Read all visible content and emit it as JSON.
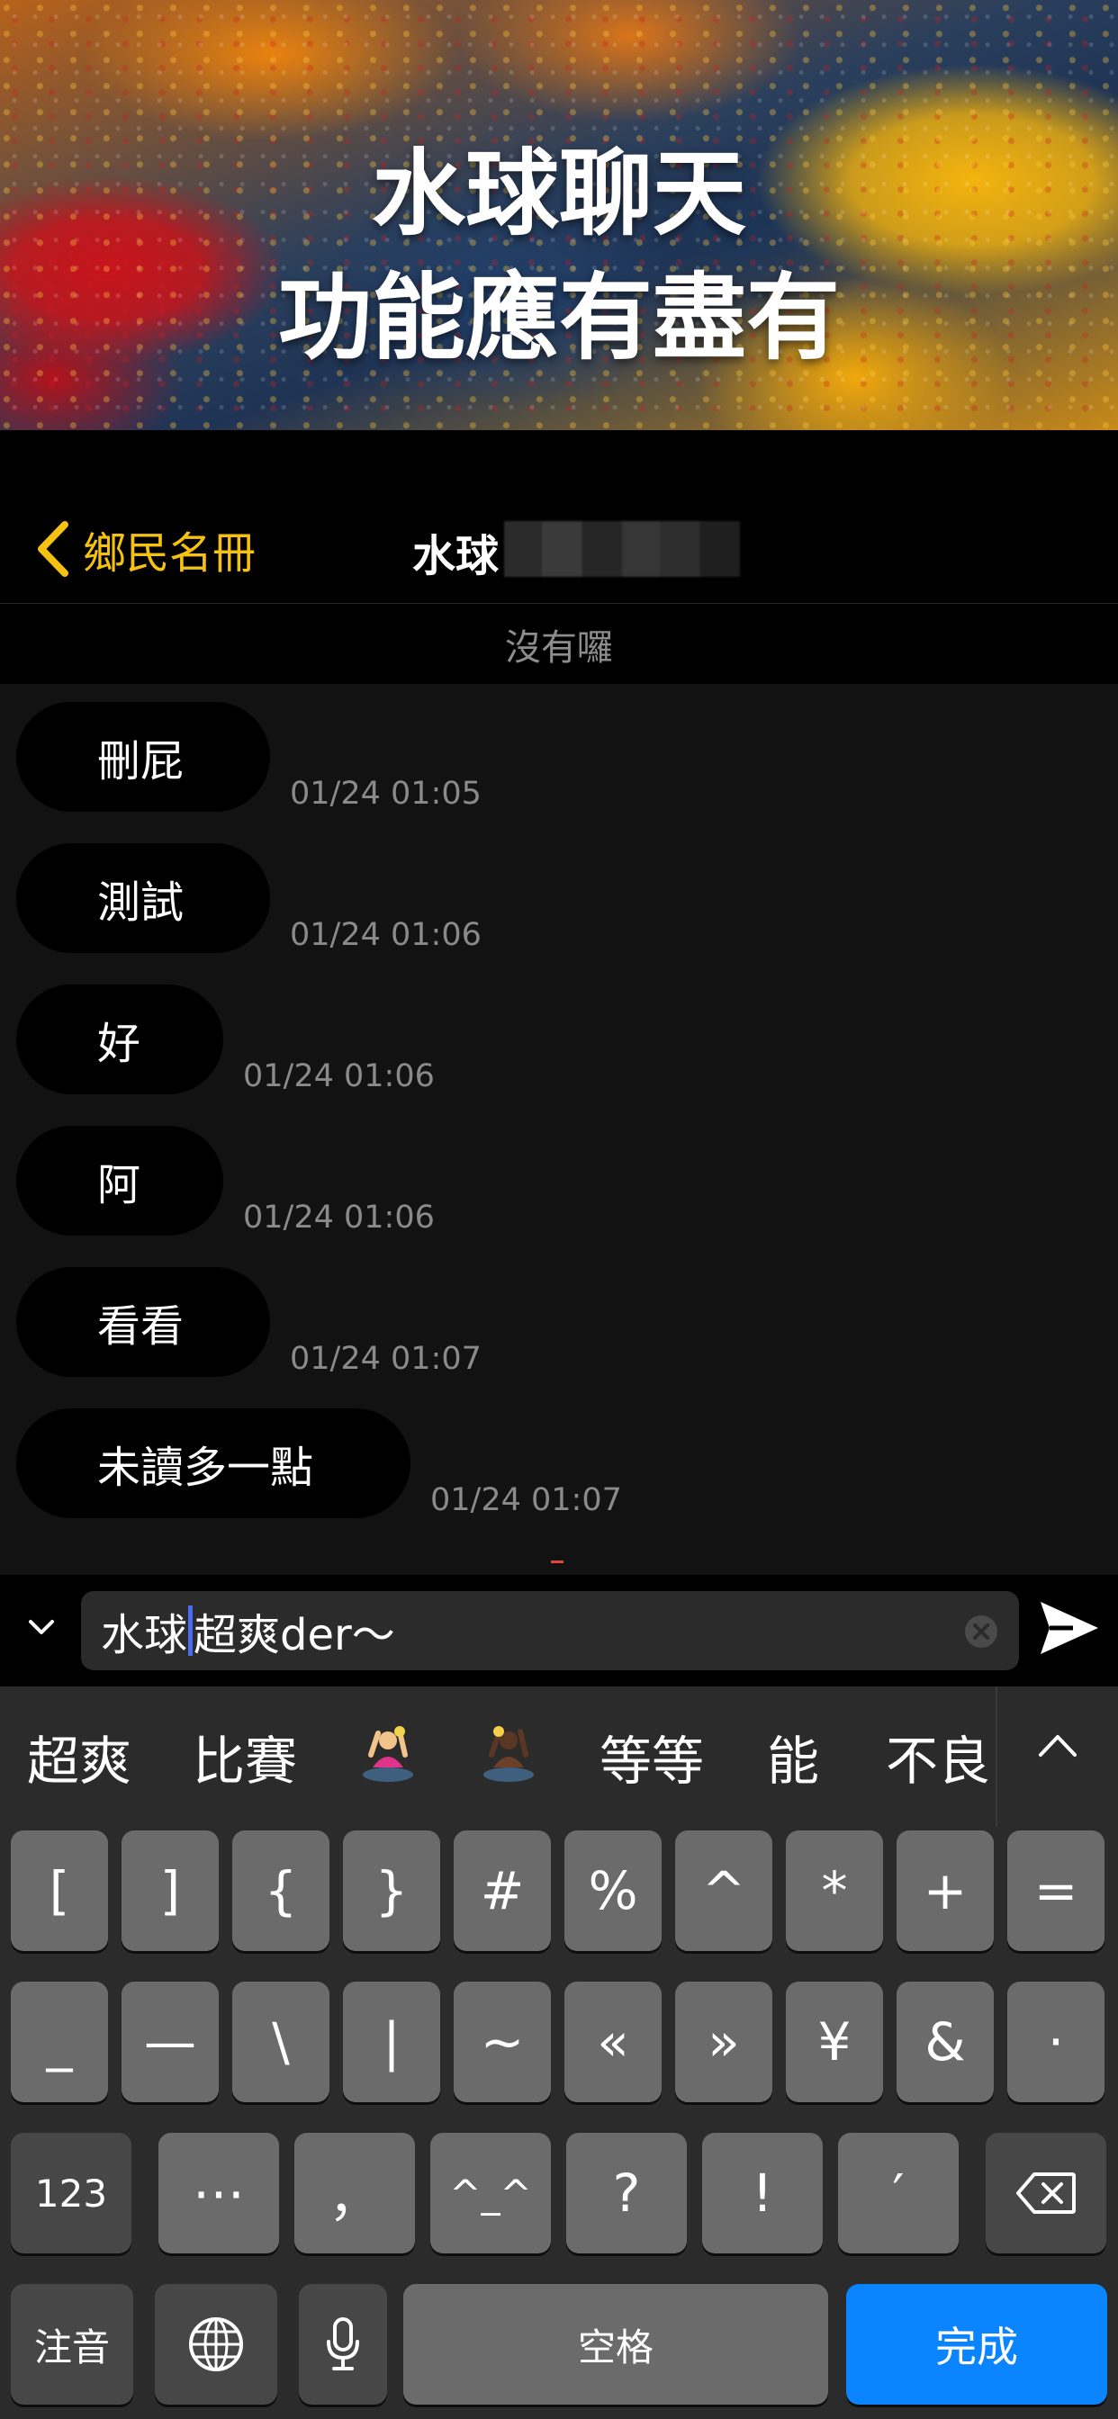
{
  "banner": {
    "line1": "水球聊天",
    "line2": "功能應有盡有"
  },
  "nav": {
    "back_label": "鄉民名冊",
    "title": "水球"
  },
  "status": {
    "text": "沒有囉"
  },
  "messages": [
    {
      "text": "刪屁",
      "time": "01/24 01:05"
    },
    {
      "text": "測試",
      "time": "01/24 01:06"
    },
    {
      "text": "好",
      "time": "01/24 01:06"
    },
    {
      "text": "阿",
      "time": "01/24 01:06"
    },
    {
      "text": "看看",
      "time": "01/24 01:07"
    },
    {
      "text": "未讀多一點",
      "time": "01/24 01:07"
    }
  ],
  "input": {
    "before_caret": "水球",
    "after_caret": "超爽der～"
  },
  "suggestions": {
    "words": [
      "超爽",
      "比賽",
      "等等",
      "能",
      "不良"
    ],
    "emoji_icons": [
      "person-in-water-light-icon",
      "person-in-water-dark-icon"
    ]
  },
  "keyboard": {
    "row1": [
      "[",
      "]",
      "{",
      "}",
      "#",
      "%",
      "^",
      "*",
      "+",
      "="
    ],
    "row2": [
      "_",
      "—",
      "\\",
      "|",
      "~",
      "«",
      "»",
      "¥",
      "&",
      "·"
    ],
    "row3": [
      "123",
      "⋯",
      "，",
      "^_^",
      "?",
      "!",
      "′"
    ],
    "row4": {
      "zhuyin": "注音",
      "space": "空格",
      "done": "完成"
    }
  },
  "colors": {
    "accent": "#f5c211",
    "done_key": "#0a84ff",
    "caret": "#4a6cf0"
  }
}
